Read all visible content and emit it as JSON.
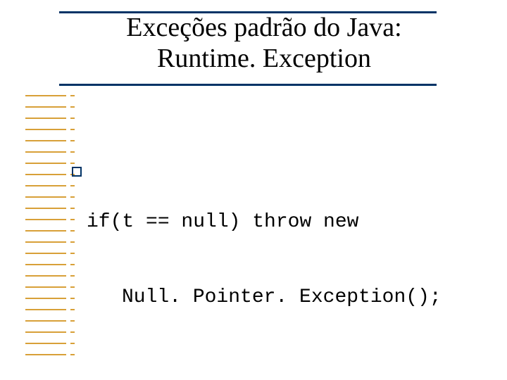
{
  "title": {
    "line1": "Exceções padrão do Java:",
    "line2": "Runtime. Exception"
  },
  "code": {
    "line1": "if(t == null) throw new",
    "line2": "Null. Pointer. Exception();"
  },
  "colors": {
    "accent_line": "#003366",
    "stripe": "#d8a038"
  }
}
